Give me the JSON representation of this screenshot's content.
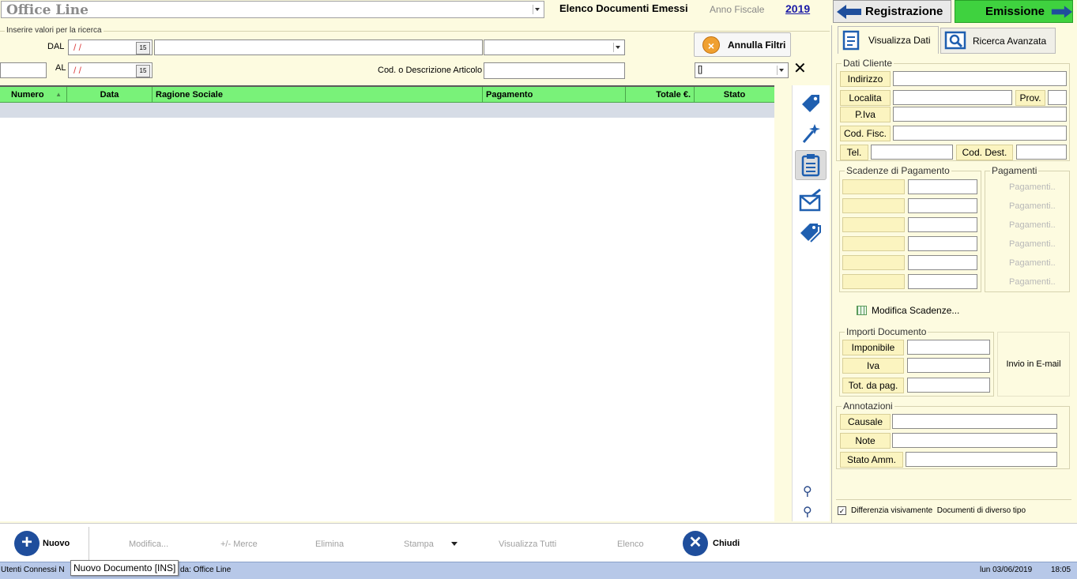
{
  "header": {
    "app_title": "Office Line",
    "list_title": "Elenco Documenti Emessi",
    "fiscal_year_label": "Anno Fiscale",
    "fiscal_year_value": "2019"
  },
  "top_buttons": {
    "registrazione": "Registrazione",
    "emissione": "Emissione"
  },
  "search": {
    "group_title": "Inserire valori per la ricerca",
    "dal_label": "DAL",
    "al_label": "AL",
    "date_placeholder": " /  /",
    "article_label": "Cod. o Descrizione Articolo",
    "clear_filters": "Annulla Filtri",
    "bracket_value": "[]"
  },
  "table": {
    "columns": [
      "Numero",
      "Data",
      "Ragione Sociale",
      "Pagamento",
      "Totale €.",
      "Stato"
    ]
  },
  "tabs": {
    "visualizza": "Visualizza Dati",
    "ricerca": "Ricerca Avanzata"
  },
  "cliente": {
    "title": "Dati Cliente",
    "indirizzo": "Indirizzo",
    "localita": "Localita",
    "prov": "Prov.",
    "piva": "P.Iva",
    "codfisc": "Cod. Fisc.",
    "tel": "Tel.",
    "coddest": "Cod. Dest."
  },
  "scadenze": {
    "title": "Scadenze di Pagamento",
    "pagamenti_title": "Pagamenti",
    "pagamenti_placeholder": "Pagamenti..",
    "modifica": "Modifica Scadenze..."
  },
  "importi": {
    "title": "Importi Documento",
    "imponibile": "Imponibile",
    "iva": "Iva",
    "totale": "Tot. da pag.",
    "email": "Invio in E-mail"
  },
  "annotazioni": {
    "title": "Annotazioni",
    "causale": "Causale",
    "note": "Note",
    "stato": "Stato Amm."
  },
  "differenzia": "Differenzia visivamente  Documenti di diverso tipo",
  "toolbar": {
    "nuovo": "Nuovo",
    "modifica": "Modifica...",
    "merce": "+/- Merce",
    "elimina": "Elimina",
    "stampa": "Stampa",
    "visualizza_tutti": "Visualizza Tutti",
    "elenco": "Elenco",
    "chiudi": "Chiudi"
  },
  "status": {
    "left_a": "Utenti Connessi N",
    "tooltip": "Nuovo Documento [INS]",
    "left_b": "da: Office Line",
    "date": "lun 03/06/2019",
    "time": "18:05"
  },
  "colors": {
    "header_green": "#79f279",
    "accent_blue": "#1f4e9c",
    "panel_yellow": "#fdfbe0"
  }
}
